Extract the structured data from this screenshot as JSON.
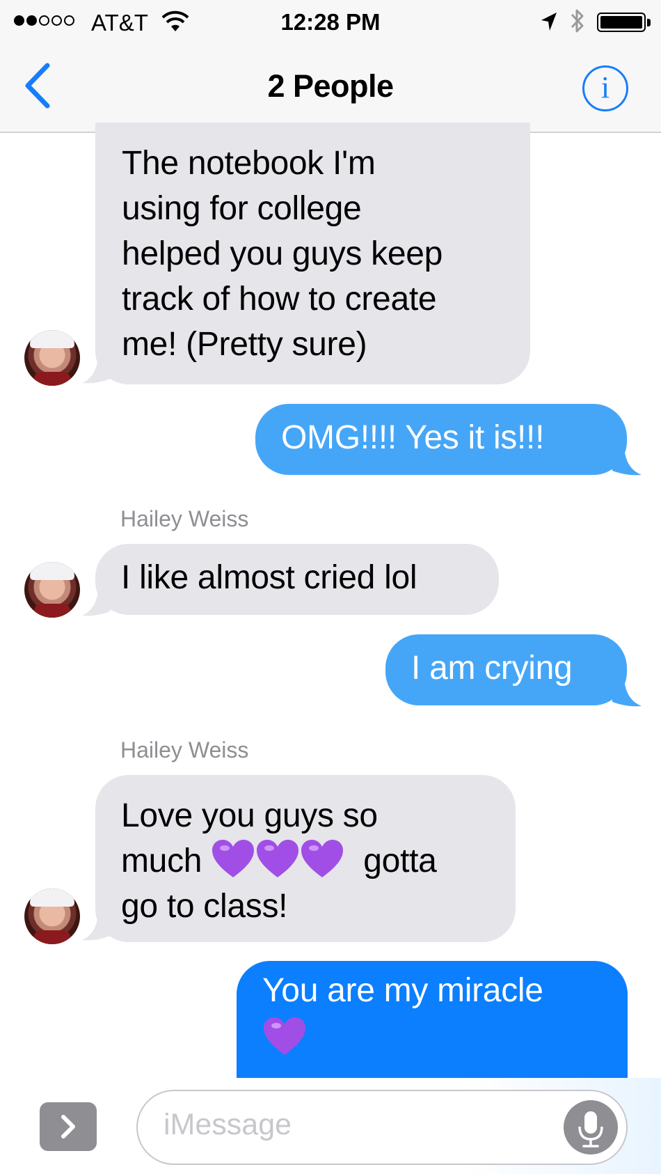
{
  "status_bar": {
    "carrier": "AT&T",
    "time": "12:28 PM",
    "signal_icon": "signal-dots-icon",
    "wifi_icon": "wifi-icon",
    "location_icon": "location-arrow-icon",
    "bluetooth_icon": "bluetooth-icon",
    "battery_icon": "battery-icon",
    "battery_level": 1.0
  },
  "nav": {
    "back_icon": "chevron-left-icon",
    "title": "2 People",
    "info_label": "i",
    "info_icon": "info-icon"
  },
  "messages": [
    {
      "direction": "received",
      "sender": "",
      "text": [
        "The notebook I'm",
        "using for college",
        "helped you guys keep",
        "track of how to create",
        "me! (Pretty sure)"
      ]
    },
    {
      "direction": "sent",
      "text": "OMG!!!! Yes it is!!!"
    },
    {
      "direction": "received",
      "sender": "Hailey Weiss",
      "text": "I like almost cried lol"
    },
    {
      "direction": "sent",
      "text": "I am crying"
    },
    {
      "direction": "received",
      "sender": "Hailey Weiss",
      "text": [
        "Love you guys so",
        "much",
        "gotta",
        "go to class!"
      ],
      "emoji": "purple-heart"
    },
    {
      "direction": "sent",
      "text": "You are my miracle",
      "emoji": "purple-heart"
    }
  ],
  "input_bar": {
    "expand_icon": "chevron-right-icon",
    "placeholder": "iMessage",
    "mic_icon": "microphone-icon"
  },
  "colors": {
    "accent": "#157efb",
    "received_bubble": "#e5e5ea",
    "sent_bubble_delivered": "#45a6f8",
    "sent_bubble_latest": "#0b7ffe",
    "heart": "#a14ee6"
  }
}
